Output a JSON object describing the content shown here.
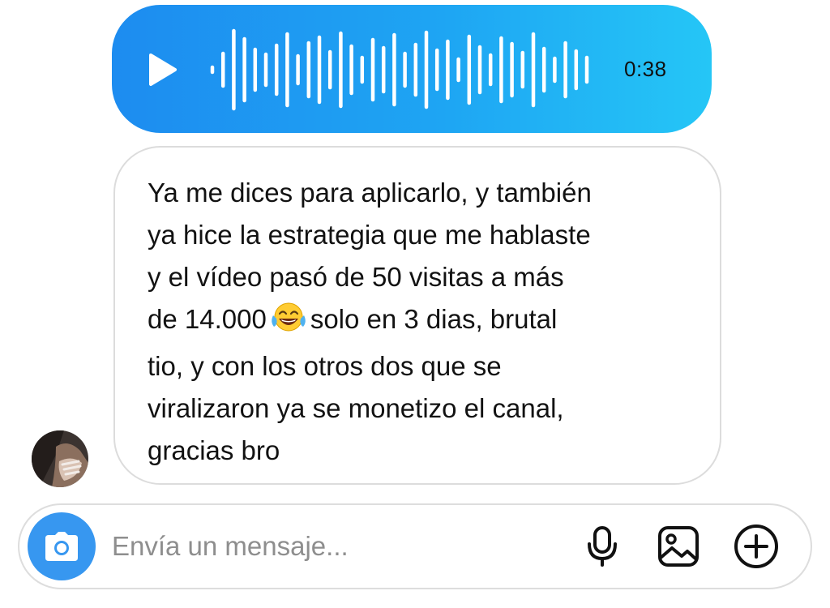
{
  "voice_message": {
    "duration": "0:38",
    "gradient_start": "#1d8cf0",
    "gradient_end": "#25c6f6",
    "play_icon": "play-icon"
  },
  "message": {
    "lines": [
      "Ya me dices para aplicarlo, y también",
      "ya hice la estrategia que me hablaste",
      "y el vídeo pasó de 50 visitas a más",
      "de 14.000",
      "solo en 3 dias, brutal",
      "tio, y con los otros dos que se",
      "viralizaron ya se monetizo el canal,",
      "gracias bro"
    ],
    "emoji": "tears-of-joy-emoji"
  },
  "composer": {
    "placeholder": "Envía un mensaje...",
    "camera_icon": "camera-icon",
    "mic_icon": "microphone-icon",
    "gallery_icon": "image-icon",
    "add_icon": "plus-circle-icon",
    "accent": "#3797f0"
  }
}
